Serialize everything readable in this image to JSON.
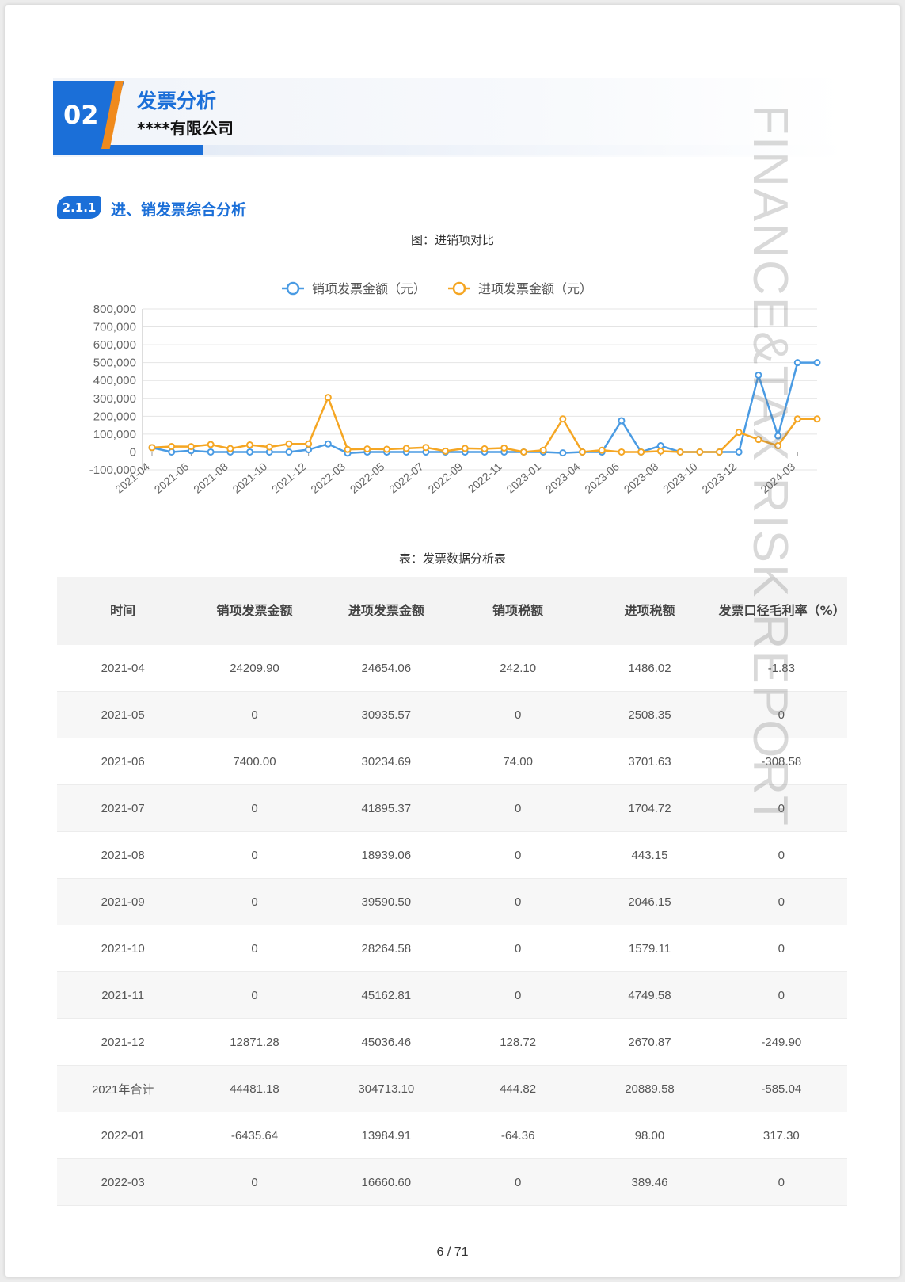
{
  "header": {
    "number": "02",
    "title": "发票分析",
    "company": "****有限公司"
  },
  "watermark": "FINANCE&TAX RISK REPORT",
  "section": {
    "number": "2.1.1",
    "title": "进、销发票综合分析"
  },
  "chart_caption": "图：进销项对比",
  "chart_data": {
    "type": "line",
    "title": "",
    "x": [
      "2021-04",
      "2021-05",
      "2021-06",
      "2021-07",
      "2021-08",
      "2021-09",
      "2021-10",
      "2021-11",
      "2021-12",
      "2022-01",
      "2022-03",
      "2022-04",
      "2022-05",
      "2022-06",
      "2022-07",
      "2022-08",
      "2022-09",
      "2022-10",
      "2022-11",
      "2022-12",
      "2023-01",
      "2023-03",
      "2023-04",
      "2023-05",
      "2023-06",
      "2023-07",
      "2023-08",
      "2023-09",
      "2023-10",
      "2023-11",
      "2023-12",
      "2024-01",
      "2024-02",
      "2024-03",
      "2024-04"
    ],
    "tick_labels": [
      "2021-04",
      "2021-06",
      "2021-08",
      "2021-10",
      "2021-12",
      "2022-03",
      "2022-05",
      "2022-07",
      "2022-09",
      "2022-11",
      "2023-01",
      "2023-04",
      "2023-06",
      "2023-08",
      "2023-10",
      "2023-12",
      "2024-03"
    ],
    "series": [
      {
        "name": "销项发票金额（元）",
        "color": "#4a9be3",
        "values": [
          24210,
          0,
          7400,
          0,
          0,
          0,
          0,
          0,
          12871,
          45000,
          -6436,
          0,
          0,
          0,
          0,
          0,
          0,
          0,
          0,
          0,
          0,
          -5000,
          0,
          0,
          175000,
          0,
          35000,
          0,
          0,
          0,
          0,
          430000,
          90000,
          500000,
          500000
        ]
      },
      {
        "name": "进项发票金额（元）",
        "color": "#f5a623",
        "values": [
          24654,
          30936,
          30235,
          41895,
          18939,
          39591,
          28265,
          45163,
          45036,
          305000,
          13985,
          16661,
          15000,
          20000,
          25000,
          5000,
          20000,
          18000,
          22000,
          0,
          10000,
          185000,
          0,
          10000,
          0,
          0,
          5000,
          0,
          0,
          0,
          110000,
          70000,
          35000,
          185000,
          185000
        ]
      }
    ],
    "y_ticks": [
      "800,000",
      "700,000",
      "600,000",
      "500,000",
      "400,000",
      "300,000",
      "200,000",
      "100,000",
      "0",
      "-100,000"
    ],
    "ylim": [
      -100000,
      800000
    ],
    "legend": "top-center",
    "grid": true
  },
  "table_caption": "表：发票数据分析表",
  "table": {
    "headers": [
      "时间",
      "销项发票金额",
      "进项发票金额",
      "销项税额",
      "进项税额",
      "发票口径毛利率（%）"
    ],
    "rows": [
      [
        "2021-04",
        "24209.90",
        "24654.06",
        "242.10",
        "1486.02",
        "-1.83"
      ],
      [
        "2021-05",
        "0",
        "30935.57",
        "0",
        "2508.35",
        "0"
      ],
      [
        "2021-06",
        "7400.00",
        "30234.69",
        "74.00",
        "3701.63",
        "-308.58"
      ],
      [
        "2021-07",
        "0",
        "41895.37",
        "0",
        "1704.72",
        "0"
      ],
      [
        "2021-08",
        "0",
        "18939.06",
        "0",
        "443.15",
        "0"
      ],
      [
        "2021-09",
        "0",
        "39590.50",
        "0",
        "2046.15",
        "0"
      ],
      [
        "2021-10",
        "0",
        "28264.58",
        "0",
        "1579.11",
        "0"
      ],
      [
        "2021-11",
        "0",
        "45162.81",
        "0",
        "4749.58",
        "0"
      ],
      [
        "2021-12",
        "12871.28",
        "45036.46",
        "128.72",
        "2670.87",
        "-249.90"
      ],
      [
        "2021年合计",
        "44481.18",
        "304713.10",
        "444.82",
        "20889.58",
        "-585.04"
      ],
      [
        "2022-01",
        "-6435.64",
        "13984.91",
        "-64.36",
        "98.00",
        "317.30"
      ],
      [
        "2022-03",
        "0",
        "16660.60",
        "0",
        "389.46",
        "0"
      ]
    ]
  },
  "page_number": "6 / 71"
}
